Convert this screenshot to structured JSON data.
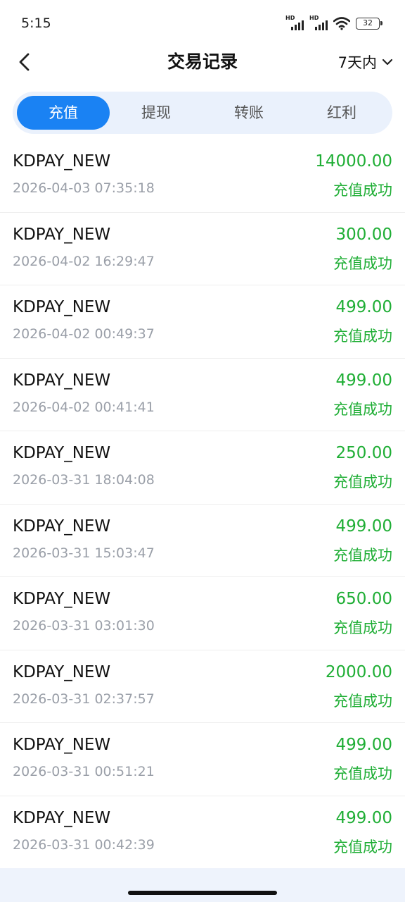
{
  "status_bar": {
    "time": "5:15",
    "battery": "32",
    "signal1_label": "HD",
    "signal2_label": "HD"
  },
  "nav": {
    "title": "交易记录",
    "range": "7天内"
  },
  "tabs": [
    {
      "label": "充值"
    },
    {
      "label": "提现"
    },
    {
      "label": "转账"
    },
    {
      "label": "红利"
    }
  ],
  "records": [
    {
      "name": "KDPAY_NEW",
      "time": "2026-04-03 07:35:18",
      "amount": "14000.00",
      "status": "充值成功"
    },
    {
      "name": "KDPAY_NEW",
      "time": "2026-04-02 16:29:47",
      "amount": "300.00",
      "status": "充值成功"
    },
    {
      "name": "KDPAY_NEW",
      "time": "2026-04-02 00:49:37",
      "amount": "499.00",
      "status": "充值成功"
    },
    {
      "name": "KDPAY_NEW",
      "time": "2026-04-02 00:41:41",
      "amount": "499.00",
      "status": "充值成功"
    },
    {
      "name": "KDPAY_NEW",
      "time": "2026-03-31 18:04:08",
      "amount": "250.00",
      "status": "充值成功"
    },
    {
      "name": "KDPAY_NEW",
      "time": "2026-03-31 15:03:47",
      "amount": "499.00",
      "status": "充值成功"
    },
    {
      "name": "KDPAY_NEW",
      "time": "2026-03-31 03:01:30",
      "amount": "650.00",
      "status": "充值成功"
    },
    {
      "name": "KDPAY_NEW",
      "time": "2026-03-31 02:37:57",
      "amount": "2000.00",
      "status": "充值成功"
    },
    {
      "name": "KDPAY_NEW",
      "time": "2026-03-31 00:51:21",
      "amount": "499.00",
      "status": "充值成功"
    },
    {
      "name": "KDPAY_NEW",
      "time": "2026-03-31 00:42:39",
      "amount": "499.00",
      "status": "充值成功"
    }
  ],
  "colors": {
    "accent": "#1a82f3",
    "success": "#1fae35",
    "tab_bg": "#eaf1fc",
    "muted": "#9a9fa8"
  }
}
